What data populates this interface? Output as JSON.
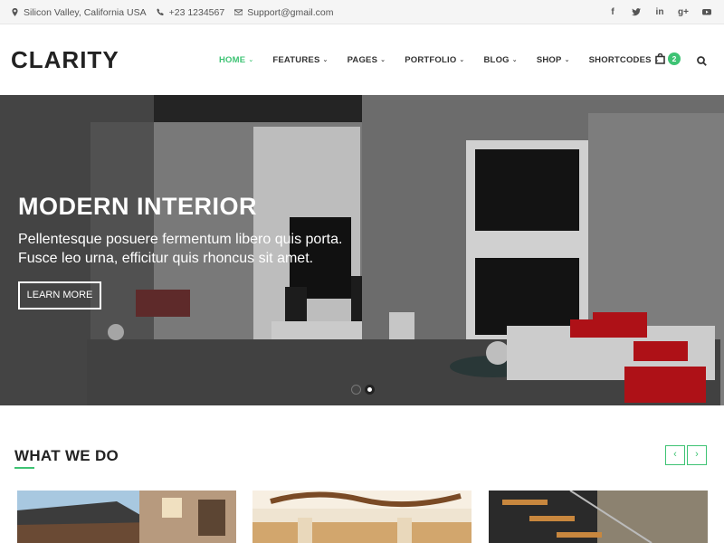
{
  "topbar": {
    "address": "Silicon Valley, California USA",
    "phone": "+23 1234567",
    "email": "Support@gmail.com",
    "social": [
      {
        "icon": "facebook-icon",
        "glyph": "f"
      },
      {
        "icon": "twitter-icon",
        "glyph": "t"
      },
      {
        "icon": "linkedin-icon",
        "glyph": "in"
      },
      {
        "icon": "google-plus-icon",
        "glyph": "g+"
      },
      {
        "icon": "youtube-icon",
        "glyph": "yt"
      }
    ]
  },
  "header": {
    "logo": "CLARITY",
    "nav": [
      "HOME",
      "FEATURES",
      "PAGES",
      "PORTFOLIO",
      "BLOG",
      "SHOP",
      "SHORTCODES"
    ],
    "active": "HOME",
    "cart_count": "2"
  },
  "hero": {
    "title": "MODERN INTERIOR",
    "subtitle_line1": "Pellentesque posuere fermentum libero quis porta.",
    "subtitle_line2": "Fusce leo urna, efficitur quis rhoncus sit amet.",
    "button": "LEARN MORE",
    "slide_count": 2,
    "active_slide": 2
  },
  "section": {
    "title": "WHAT WE DO",
    "prev": "‹",
    "next": "›"
  },
  "colors": {
    "accent": "#3ec374",
    "text": "#333333"
  }
}
